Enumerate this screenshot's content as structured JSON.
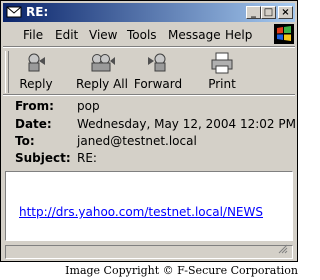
{
  "window": {
    "title": "RE:"
  },
  "caption_buttons": {
    "minimize": "_",
    "maximize": "□",
    "close": "×"
  },
  "menu": [
    "File",
    "Edit",
    "View",
    "Tools",
    "Message",
    "Help"
  ],
  "toolbar": [
    {
      "label": "Reply",
      "icon": "reply-icon"
    },
    {
      "label": "Reply All",
      "icon": "reply-all-icon"
    },
    {
      "label": "Forward",
      "icon": "forward-icon"
    },
    {
      "label": "Print",
      "icon": "printer-icon"
    }
  ],
  "headers": {
    "from_label": "From:",
    "from": "pop",
    "date_label": "Date:",
    "date": "Wednesday, May 12, 2004 12:02 PM",
    "to_label": "To:",
    "to": "janed@testnet.local",
    "subject_label": "Subject:",
    "subject": "RE:"
  },
  "message": {
    "link": "http://drs.yahoo.com/testnet.local/NEWS"
  },
  "footer": {
    "copyright": "Image Copyright © F-Secure Corporation"
  },
  "colors": {
    "title_start": "#0a246a",
    "title_end": "#a6caf0",
    "link": "#0000ff",
    "face": "#d4d0c8"
  }
}
